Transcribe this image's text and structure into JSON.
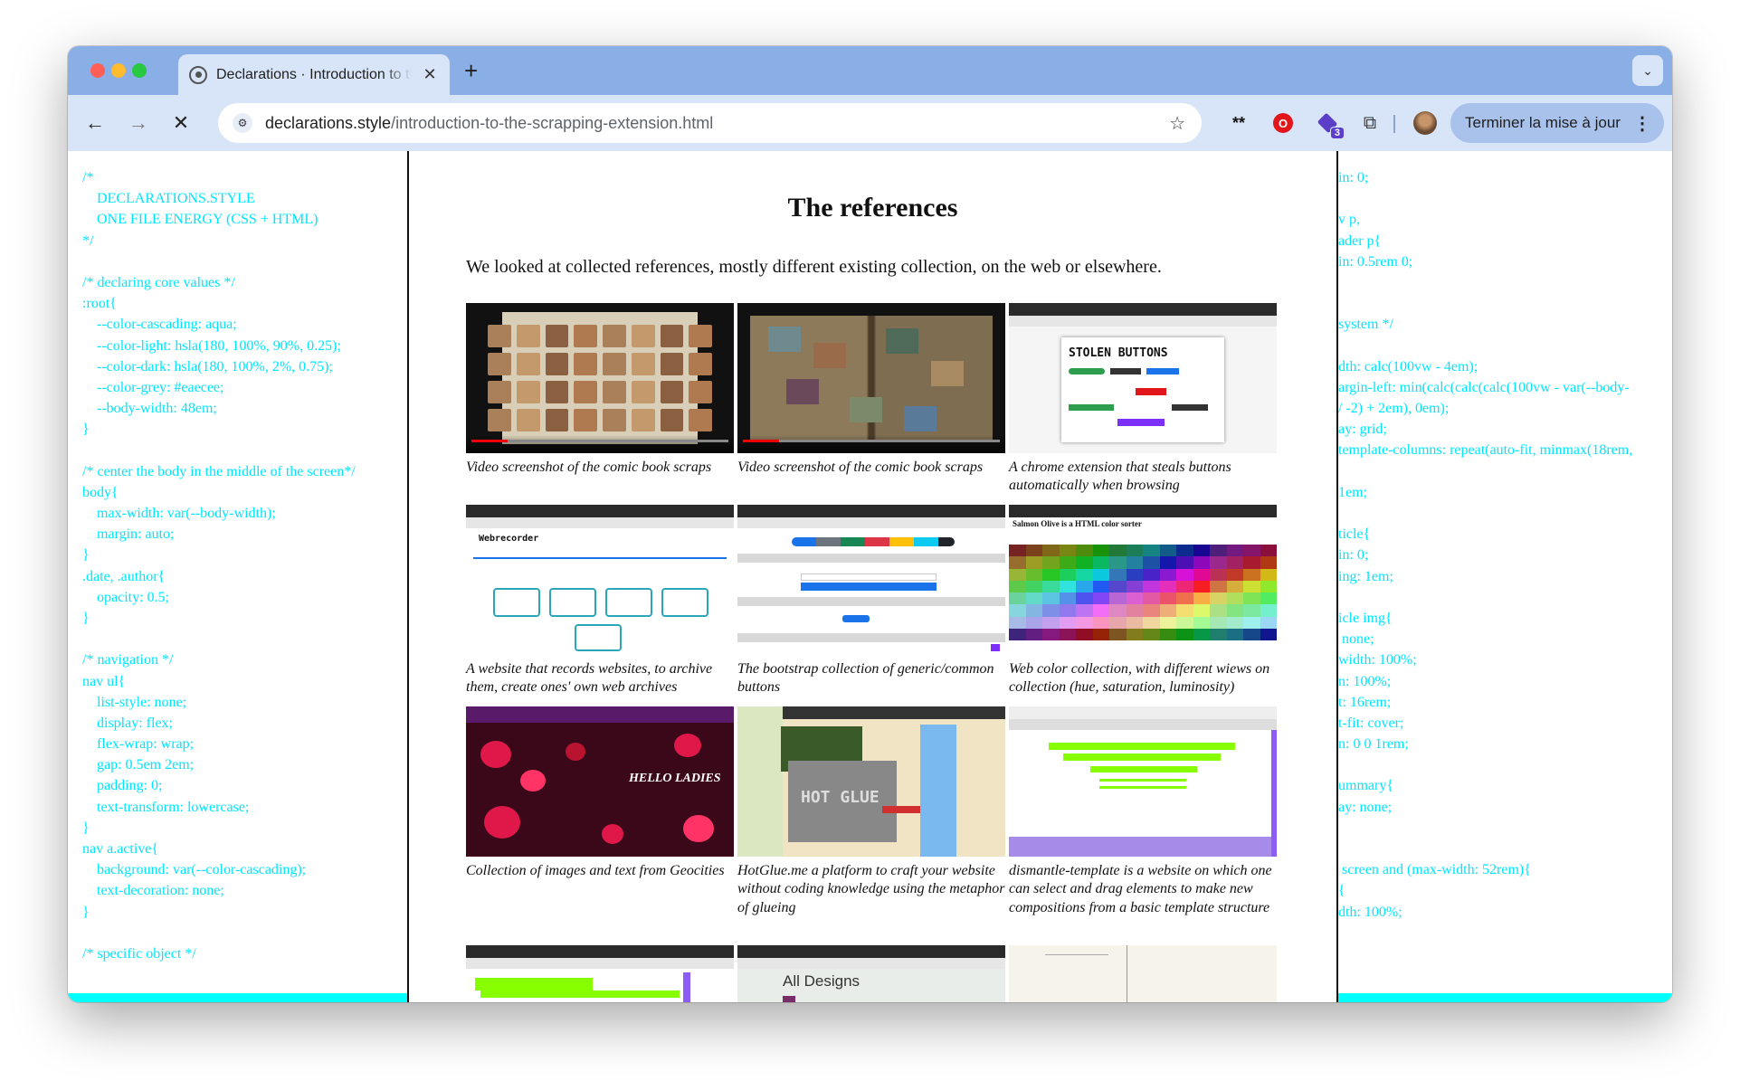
{
  "browser": {
    "tab_title": "Declarations · Introduction to the scrapping extension",
    "tab_close": "✕",
    "new_tab": "+",
    "url_domain": "declarations.style",
    "url_path": "/introduction-to-the-scrapping-extension.html",
    "extension_badge": "3",
    "update_button": "Terminer la mise à jour",
    "icons": [
      "back-icon",
      "forward-icon",
      "stop-icon",
      "site-info-icon",
      "bookmark-star-icon",
      "extension-icon",
      "puzzle-icon",
      "profile-avatar",
      "menu-icon"
    ]
  },
  "code_left": [
    "/*",
    "    DECLARATIONS.STYLE",
    "    ONE FILE ENERGY (CSS + HTML)",
    "*/",
    "",
    "/* declaring core values */",
    ":root{",
    "    --color-cascading: aqua;",
    "    --color-light: hsla(180, 100%, 90%, 0.25);",
    "    --color-dark: hsla(180, 100%, 2%, 0.75);",
    "    --color-grey: #eaecee;",
    "    --body-width: 48em;",
    "}",
    "",
    "/* center the body in the middle of the screen*/",
    "body{",
    "    max-width: var(--body-width);",
    "    margin: auto;",
    "}",
    ".date, .author{",
    "    opacity: 0.5;",
    "}",
    "",
    "/* navigation */",
    "nav ul{",
    "    list-style: none;",
    "    display: flex;",
    "    flex-wrap: wrap;",
    "    gap: 0.5em 2em;",
    "    padding: 0;",
    "    text-transform: lowercase;",
    "}",
    "nav a.active{",
    "    background: var(--color-cascading);",
    "    text-decoration: none;",
    "}",
    "",
    "/* specific object */"
  ],
  "code_right": [
    "in: 0;",
    "",
    "v p,",
    "ader p{",
    "in: 0.5rem 0;",
    "",
    "",
    "system */",
    "",
    "dth: calc(100vw - 4em);",
    "argin-left: min(calc(calc(calc(100vw - var(--body-",
    "/ -2) + 2em), 0em);",
    "ay: grid;",
    "template-columns: repeat(auto-fit, minmax(18rem,",
    "",
    "1em;",
    "",
    "ticle{",
    "in: 0;",
    "ing: 1em;",
    "",
    "icle img{",
    " none;",
    "width: 100%;",
    "n: 100%;",
    "t: 16rem;",
    "t-fit: cover;",
    "n: 0 0 1rem;",
    "",
    "ummary{",
    "ay: none;",
    "",
    "",
    " screen and (max-width: 52rem){",
    "{",
    "dth: 100%;"
  ],
  "main": {
    "title": "The references",
    "intro": "We looked at collected references, mostly different existing collection, on the web or elsewhere.",
    "cards": [
      {
        "caption": "Video screenshot of the comic book scraps"
      },
      {
        "caption": "Video screenshot of the comic book scraps"
      },
      {
        "caption": "A chrome extension that steals buttons automatically when browsing",
        "thumb_label": "STOLEN BUTTONS"
      },
      {
        "caption": "A website that records websites, to archive them, create ones' own web archives",
        "thumb_label": "Webrecorder"
      },
      {
        "caption": "The bootstrap collection of generic/common buttons"
      },
      {
        "caption": "Web color collection, with different wiews on collection (hue, saturation, luminosity)",
        "thumb_label": "Salmon Olive is a HTML color sorter"
      },
      {
        "caption": "Collection of images and text from Geocities",
        "thumb_label": "HELLO LADIES"
      },
      {
        "caption": "HotGlue.me a platform to craft your website without coding knowledge using the metaphor of glueing",
        "thumb_label": "HOT GLUE"
      },
      {
        "caption": "dismantle-template is a website on which one can select and drag elements to make new compositions from a basic template structure"
      },
      {
        "caption": ""
      },
      {
        "caption": "",
        "thumb_label": "All Designs"
      },
      {
        "caption": ""
      }
    ]
  }
}
